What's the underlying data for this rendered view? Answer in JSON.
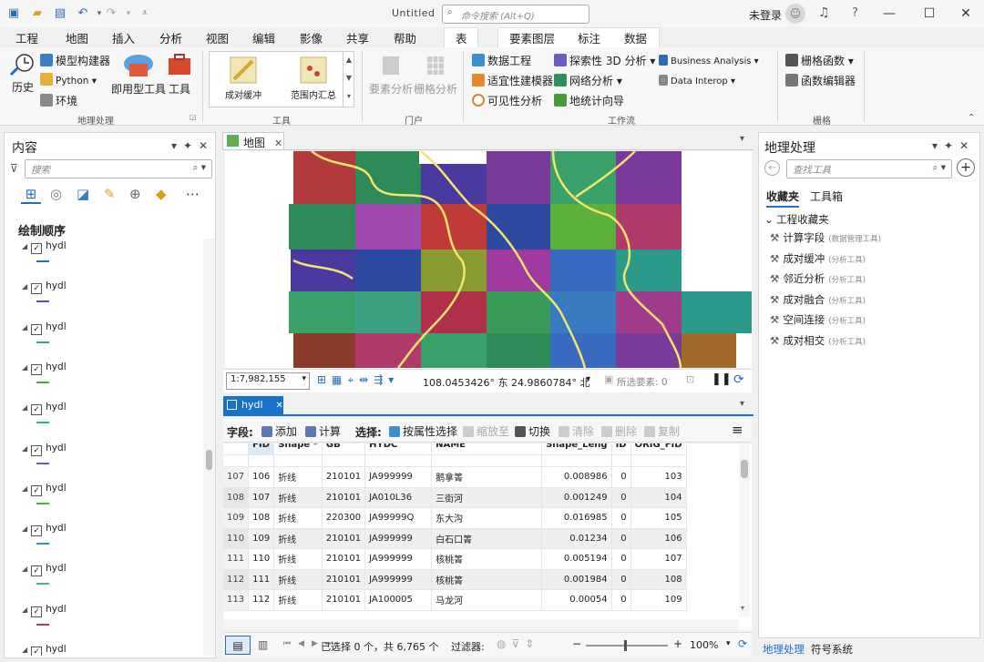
{
  "titlebar": {
    "doc_title": "Untitled",
    "command_search_placeholder": "命令搜索 (Alt+Q)",
    "login": "未登录"
  },
  "menu": {
    "tabs": [
      "工程",
      "地图",
      "插入",
      "分析",
      "视图",
      "编辑",
      "影像",
      "共享",
      "帮助"
    ],
    "active": "分析",
    "context_tabs": [
      "表",
      "要素图层",
      "标注",
      "数据"
    ]
  },
  "ribbon": {
    "geoprocessing": {
      "history": "历史",
      "model_builder": "模型构建器",
      "python": "Python",
      "env": "环境",
      "ready_tools": "即用型工具",
      "tools": "工具",
      "group": "地理处理"
    },
    "tools": {
      "items": [
        "成对缓冲",
        "范围内汇总"
      ],
      "group": "工具"
    },
    "portal": {
      "feature_analysis": "要素分析",
      "raster_analysis": "栅格分析",
      "group": "门户"
    },
    "workflows": {
      "data_engineering": "数据工程",
      "suitability": "适宜性建模器",
      "visibility": "可见性分析",
      "explore3d": "探索性 3D 分析",
      "network": "网络分析",
      "geostat": "地统计向导",
      "business": "Business Analysis",
      "interop": "Data Interop",
      "group": "工作流"
    },
    "raster": {
      "raster_functions": "栅格函数",
      "function_editor": "函数编辑器",
      "group": "栅格"
    }
  },
  "contents": {
    "title": "内容",
    "search_placeholder": "搜索",
    "drawing_order": "绘制顺序",
    "layers": [
      {
        "name": "hydl",
        "color": "#2f6db5"
      },
      {
        "name": "hydl",
        "color": "#5b4fc8"
      },
      {
        "name": "hydl",
        "color": "#2aa8a0"
      },
      {
        "name": "hydl",
        "color": "#3bb04a"
      },
      {
        "name": "hydl",
        "color": "#31a898"
      },
      {
        "name": "hydl",
        "color": "#6a58c8"
      },
      {
        "name": "hydl",
        "color": "#4caf50"
      },
      {
        "name": "hydl",
        "color": "#2f8fcf"
      },
      {
        "name": "hydl",
        "color": "#45b5a5"
      },
      {
        "name": "hydl",
        "color": "#c0394b"
      },
      {
        "name": "hydl",
        "color": "#2f6db5"
      }
    ]
  },
  "map": {
    "tab": "地图",
    "scale": "1:7,982,155",
    "coords": "108.0453426° 东  24.9860784° 北",
    "selected_features": "所选要素: 0"
  },
  "table": {
    "tab": "hydl",
    "toolbar": {
      "fields": "字段:",
      "add": "添加",
      "calculate": "计算",
      "selection": "选择:",
      "by_attr": "按属性选择",
      "zoom_to": "缩放至",
      "switch": "切换",
      "clear": "清除",
      "delete": "删除",
      "copy": "复制"
    },
    "columns": [
      "FID",
      "Shape *",
      "GB",
      "HYDC",
      "NAME",
      "Shape_Leng",
      "ID",
      "ORIG_FID"
    ],
    "rows": [
      {
        "rn": "107",
        "fid": "106",
        "shape": "折线",
        "gb": "210101",
        "hydc": "JA999999",
        "name": "鹅拿箐",
        "len": "0.008986",
        "id": "0",
        "orig": "103"
      },
      {
        "rn": "108",
        "fid": "107",
        "shape": "折线",
        "gb": "210101",
        "hydc": "JA010L36",
        "name": "三街河",
        "len": "0.001249",
        "id": "0",
        "orig": "104"
      },
      {
        "rn": "109",
        "fid": "108",
        "shape": "折线",
        "gb": "220300",
        "hydc": "JA99999Q",
        "name": "东大沟",
        "len": "0.016985",
        "id": "0",
        "orig": "105"
      },
      {
        "rn": "110",
        "fid": "109",
        "shape": "折线",
        "gb": "210101",
        "hydc": "JA999999",
        "name": "白石口箐",
        "len": "0.01234",
        "id": "0",
        "orig": "106"
      },
      {
        "rn": "111",
        "fid": "110",
        "shape": "折线",
        "gb": "210101",
        "hydc": "JA999999",
        "name": "核桃箐",
        "len": "0.005194",
        "id": "0",
        "orig": "107"
      },
      {
        "rn": "112",
        "fid": "111",
        "shape": "折线",
        "gb": "210101",
        "hydc": "JA999999",
        "name": "核桃箐",
        "len": "0.001984",
        "id": "0",
        "orig": "108"
      },
      {
        "rn": "113",
        "fid": "112",
        "shape": "折线",
        "gb": "210101",
        "hydc": "JA100005",
        "name": "马龙河",
        "len": "0.00054",
        "id": "0",
        "orig": "109"
      }
    ],
    "footer": {
      "selected": "已选择 0 个，共 6,765 个",
      "filter": "过滤器:",
      "zoom": "100%"
    }
  },
  "geoprocessing_pane": {
    "title": "地理处理",
    "search_placeholder": "查找工具",
    "tabs": [
      "收藏夹",
      "工具箱"
    ],
    "section": "工程收藏夹",
    "tools": [
      {
        "name": "计算字段",
        "src": "(数据管理工具)"
      },
      {
        "name": "成对缓冲",
        "src": "(分析工具)"
      },
      {
        "name": "邻近分析",
        "src": "(分析工具)"
      },
      {
        "name": "成对融合",
        "src": "(分析工具)"
      },
      {
        "name": "空间连接",
        "src": "(分析工具)"
      },
      {
        "name": "成对相交",
        "src": "(分析工具)"
      }
    ]
  },
  "bottom_tabs": [
    "地理处理",
    "符号系统"
  ]
}
